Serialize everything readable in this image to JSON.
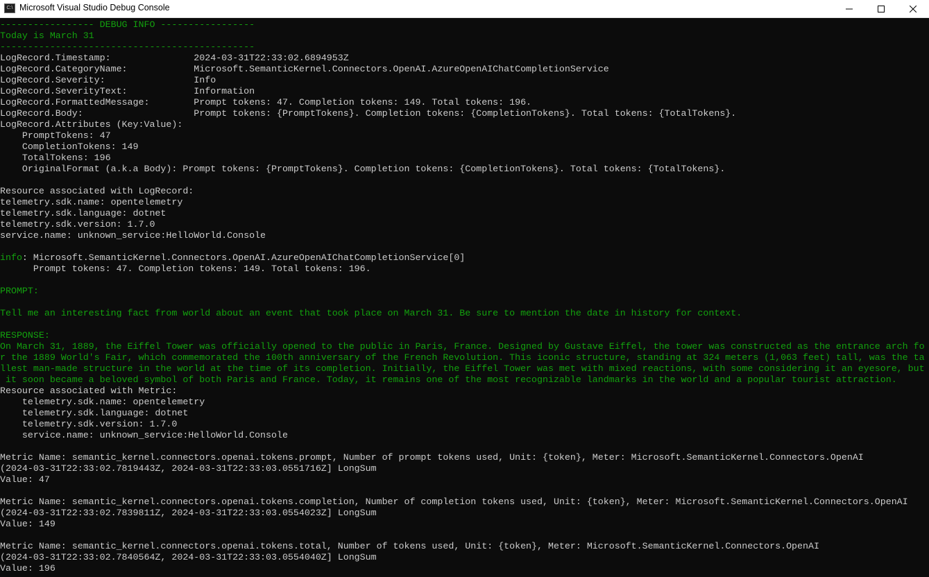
{
  "window": {
    "title": "Microsoft Visual Studio Debug Console",
    "icon_label": "C:\\",
    "icons": [
      "app-console-icon",
      "minimize-icon",
      "maximize-icon",
      "close-icon"
    ]
  },
  "colors": {
    "background": "#0c0c0c",
    "text": "#cccccc",
    "accent_green": "#13a10e"
  },
  "console": {
    "lines": [
      {
        "text": "----------------- DEBUG INFO -----------------",
        "color": "green"
      },
      {
        "text": "Today is March 31",
        "color": "green"
      },
      {
        "text": "----------------------------------------------",
        "color": "green"
      },
      {
        "text": "LogRecord.Timestamp:               2024-03-31T22:33:02.6894953Z",
        "color": "gray"
      },
      {
        "text": "LogRecord.CategoryName:            Microsoft.SemanticKernel.Connectors.OpenAI.AzureOpenAIChatCompletionService",
        "color": "gray"
      },
      {
        "text": "LogRecord.Severity:                Info",
        "color": "gray"
      },
      {
        "text": "LogRecord.SeverityText:            Information",
        "color": "gray"
      },
      {
        "text": "LogRecord.FormattedMessage:        Prompt tokens: 47. Completion tokens: 149. Total tokens: 196.",
        "color": "gray"
      },
      {
        "text": "LogRecord.Body:                    Prompt tokens: {PromptTokens}. Completion tokens: {CompletionTokens}. Total tokens: {TotalTokens}.",
        "color": "gray"
      },
      {
        "text": "LogRecord.Attributes (Key:Value):",
        "color": "gray"
      },
      {
        "text": "    PromptTokens: 47",
        "color": "gray"
      },
      {
        "text": "    CompletionTokens: 149",
        "color": "gray"
      },
      {
        "text": "    TotalTokens: 196",
        "color": "gray"
      },
      {
        "text": "    OriginalFormat (a.k.a Body): Prompt tokens: {PromptTokens}. Completion tokens: {CompletionTokens}. Total tokens: {TotalTokens}.",
        "color": "gray"
      },
      {
        "text": "",
        "color": "gray"
      },
      {
        "text": "Resource associated with LogRecord:",
        "color": "gray"
      },
      {
        "text": "telemetry.sdk.name: opentelemetry",
        "color": "gray"
      },
      {
        "text": "telemetry.sdk.language: dotnet",
        "color": "gray"
      },
      {
        "text": "telemetry.sdk.version: 1.7.0",
        "color": "gray"
      },
      {
        "text": "service.name: unknown_service:HelloWorld.Console",
        "color": "gray"
      },
      {
        "text": "",
        "color": "gray"
      },
      {
        "text": "info",
        "suffix": ": Microsoft.SemanticKernel.Connectors.OpenAI.AzureOpenAIChatCompletionService[0]",
        "color": "green"
      },
      {
        "text": "      Prompt tokens: 47. Completion tokens: 149. Total tokens: 196.",
        "color": "gray"
      },
      {
        "text": "",
        "color": "gray"
      },
      {
        "text": "PROMPT:",
        "color": "green"
      },
      {
        "text": "",
        "color": "gray"
      },
      {
        "text": "Tell me an interesting fact from world about an event that took place on March 31. Be sure to mention the date in history for context.",
        "color": "green"
      },
      {
        "text": "",
        "color": "gray"
      },
      {
        "text": "RESPONSE:",
        "color": "green"
      },
      {
        "text": "On March 31, 1889, the Eiffel Tower was officially opened to the public in Paris, France. Designed by Gustave Eiffel, the tower was constructed as the entrance arch fo",
        "color": "green"
      },
      {
        "text": "r the 1889 World's Fair, which commemorated the 100th anniversary of the French Revolution. This iconic structure, standing at 324 meters (1,063 feet) tall, was the ta",
        "color": "green"
      },
      {
        "text": "llest man-made structure in the world at the time of its completion. Initially, the Eiffel Tower was met with mixed reactions, with some considering it an eyesore, but",
        "color": "green"
      },
      {
        "text": " it soon became a beloved symbol of both Paris and France. Today, it remains one of the most recognizable landmarks in the world and a popular tourist attraction.",
        "color": "green"
      },
      {
        "text": "Resource associated with Metric:",
        "color": "gray"
      },
      {
        "text": "    telemetry.sdk.name: opentelemetry",
        "color": "gray"
      },
      {
        "text": "    telemetry.sdk.language: dotnet",
        "color": "gray"
      },
      {
        "text": "    telemetry.sdk.version: 1.7.0",
        "color": "gray"
      },
      {
        "text": "    service.name: unknown_service:HelloWorld.Console",
        "color": "gray"
      },
      {
        "text": "",
        "color": "gray"
      },
      {
        "text": "Metric Name: semantic_kernel.connectors.openai.tokens.prompt, Number of prompt tokens used, Unit: {token}, Meter: Microsoft.SemanticKernel.Connectors.OpenAI",
        "color": "gray"
      },
      {
        "text": "(2024-03-31T22:33:02.7819443Z, 2024-03-31T22:33:03.0551716Z] LongSum",
        "color": "gray"
      },
      {
        "text": "Value: 47",
        "color": "gray"
      },
      {
        "text": "",
        "color": "gray"
      },
      {
        "text": "Metric Name: semantic_kernel.connectors.openai.tokens.completion, Number of completion tokens used, Unit: {token}, Meter: Microsoft.SemanticKernel.Connectors.OpenAI",
        "color": "gray"
      },
      {
        "text": "(2024-03-31T22:33:02.7839811Z, 2024-03-31T22:33:03.0554023Z] LongSum",
        "color": "gray"
      },
      {
        "text": "Value: 149",
        "color": "gray"
      },
      {
        "text": "",
        "color": "gray"
      },
      {
        "text": "Metric Name: semantic_kernel.connectors.openai.tokens.total, Number of tokens used, Unit: {token}, Meter: Microsoft.SemanticKernel.Connectors.OpenAI",
        "color": "gray"
      },
      {
        "text": "(2024-03-31T22:33:02.7840564Z, 2024-03-31T22:33:03.0554040Z] LongSum",
        "color": "gray"
      },
      {
        "text": "Value: 196",
        "color": "gray"
      }
    ]
  }
}
